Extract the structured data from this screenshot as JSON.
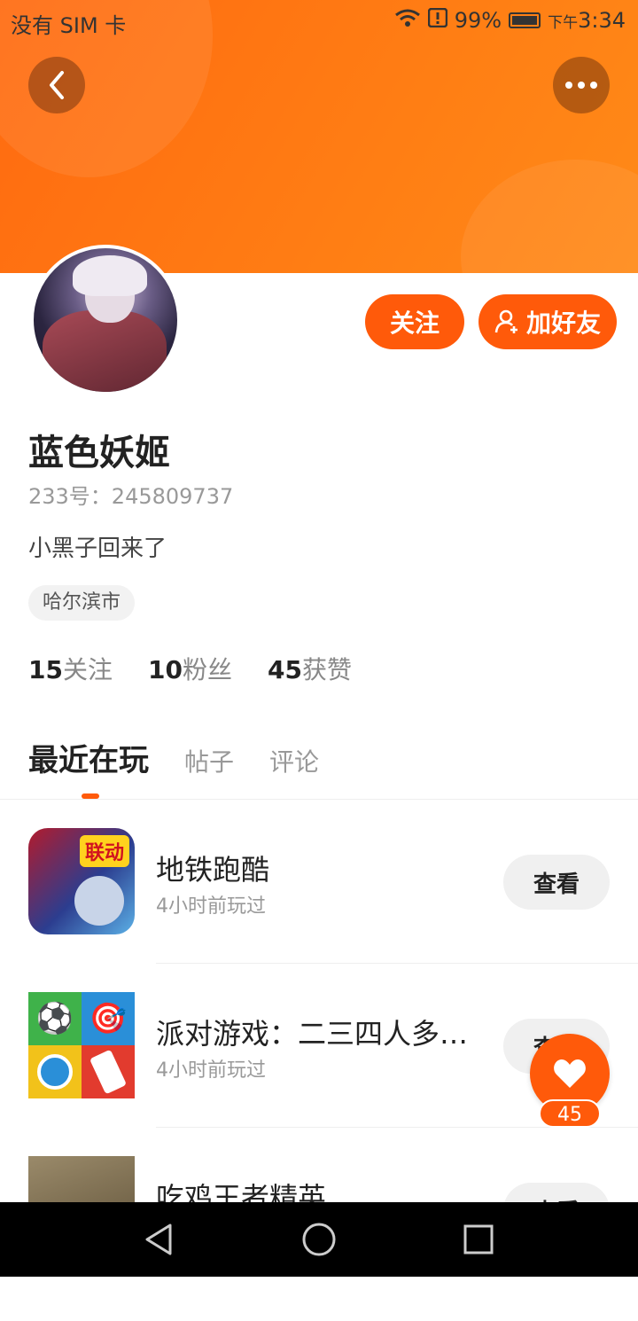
{
  "status_bar": {
    "carrier": "没有 SIM 卡",
    "battery": "99%",
    "time_prefix": "下午",
    "time": "3:34"
  },
  "header": {
    "back_icon": "chevron-left-icon",
    "more_icon": "more-dots-icon"
  },
  "profile": {
    "follow_label": "关注",
    "add_friend_label": "加好友",
    "name": "蓝色妖姬",
    "uid": "233号：245809737",
    "bio": "小黑子回来了",
    "location": "哈尔滨市",
    "stats": [
      {
        "value": "15",
        "label": "关注"
      },
      {
        "value": "10",
        "label": "粉丝"
      },
      {
        "value": "45",
        "label": "获赞"
      }
    ]
  },
  "tabs": {
    "active": "最近在玩",
    "items": [
      "帖子",
      "评论"
    ]
  },
  "games": [
    {
      "title": "地铁跑酷",
      "sub": "4小时前玩过",
      "button": "查看",
      "icon_text": "联动"
    },
    {
      "title": "派对游戏：二三四人多人游戏",
      "sub": "4小时前玩过",
      "button": "查看"
    },
    {
      "title": "吃鸡王者精英",
      "sub": "",
      "button": "查看"
    }
  ],
  "like_fab": {
    "count": "45"
  },
  "colors": {
    "accent": "#ff5a0a",
    "header": "#ff7a12"
  }
}
